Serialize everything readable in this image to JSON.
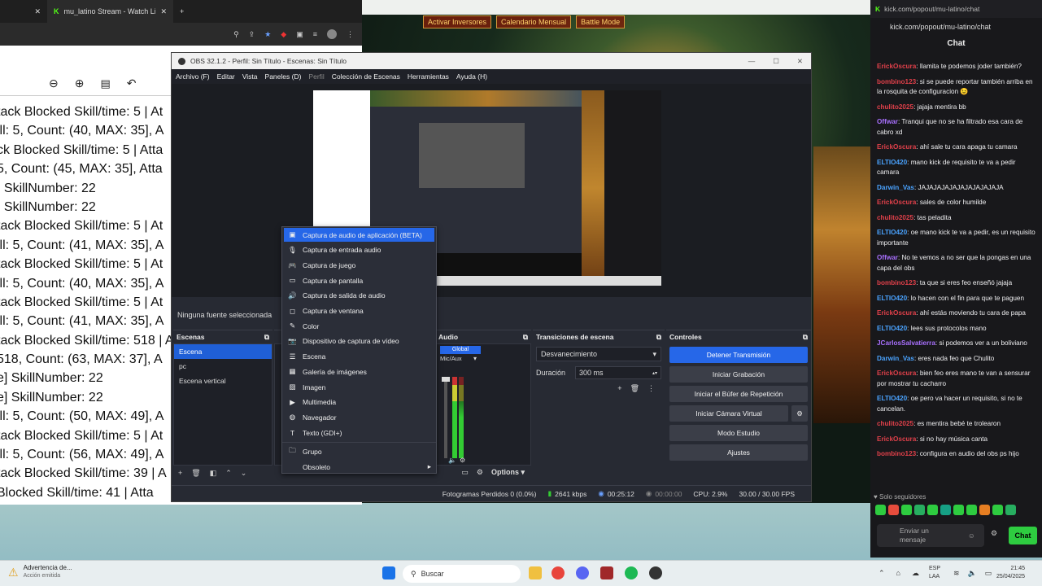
{
  "browser": {
    "tabs": [
      {
        "label": ""
      },
      {
        "label": "mu_latino Stream - Watch Live"
      }
    ],
    "log_lines": [
      "tack Blocked Skill/time: 5 | At",
      "ill: 5, Count: (40, MAX: 35], A",
      "ck Blocked Skill/time: 5 | Atta",
      "5, Count: (45, MAX: 35], Atta",
      "] SkillNumber: 22",
      "] SkillNumber: 22",
      "tack Blocked Skill/time: 5 | At",
      "ill: 5, Count: (41, MAX: 35], A",
      "tack Blocked Skill/time: 5 | At",
      "ill: 5, Count: (40, MAX: 35], A",
      "tack Blocked Skill/time: 5 | At",
      "ill: 5, Count: (41, MAX: 35], A",
      "tack Blocked Skill/time: 518 | A",
      " 518, Count: (63, MAX: 37], A",
      "e] SkillNumber: 22",
      "e] SkillNumber: 22",
      "ill: 5, Count: (50, MAX: 49], A",
      "tack Blocked Skill/time: 5 | At",
      "ill: 5, Count: (56, MAX: 49], A",
      "tack Blocked Skill/time: 39 | A",
      " Blocked Skill/time: 41 | Atta"
    ]
  },
  "game": {
    "hud": [
      "Activar Inversores",
      "Calendario Mensual",
      "Battle Mode"
    ]
  },
  "obs": {
    "title": "OBS 32.1.2 - Perfil: Sin Título - Escenas: Sin Título",
    "menu": [
      "Archivo (F)",
      "Editar",
      "Vista",
      "Paneles (D)",
      "Perfil",
      "Colección de Escenas",
      "Herramientas",
      "Ayuda (H)"
    ],
    "no_source": "Ninguna fuente seleccionada",
    "scenes": {
      "header": "Escenas",
      "items": [
        {
          "label": "Escena",
          "selected": true
        },
        {
          "label": "pc",
          "selected": false
        },
        {
          "label": "Escena vertical",
          "selected": false
        }
      ]
    },
    "audio": {
      "header": "Audio",
      "channel_label": "Global",
      "channel_name": "Mic/Aux"
    },
    "transitions": {
      "header": "Transiciones de escena",
      "selected": "Desvanecimiento",
      "duration_label": "Duración",
      "duration_value": "300 ms"
    },
    "controls": {
      "header": "Controles",
      "buttons": [
        "Detener Transmisión",
        "Iniciar Grabación",
        "Iniciar el Búfer de Repetición",
        "Iniciar Cámara Virtual",
        "Modo Estudio",
        "Ajustes"
      ]
    },
    "options_label": "Options",
    "status": {
      "dropped": "Fotogramas Perdidos 0 (0.0%)",
      "bitrate": "2641 kbps",
      "time": "00:25:12",
      "rec_time": "00:00:00",
      "cpu": "CPU: 2.9%",
      "fps": "30.00 / 30.00 FPS"
    },
    "context_menu": [
      {
        "label": "Captura de audio de aplicación (BETA)",
        "icon": "app-audio-icon",
        "highlighted": true
      },
      {
        "label": "Captura de entrada audio",
        "icon": "mic-icon"
      },
      {
        "label": "Captura de juego",
        "icon": "gamepad-icon"
      },
      {
        "label": "Captura de pantalla",
        "icon": "monitor-icon"
      },
      {
        "label": "Captura de salida de audio",
        "icon": "speaker-icon"
      },
      {
        "label": "Captura de ventana",
        "icon": "window-icon"
      },
      {
        "label": "Color",
        "icon": "brush-icon"
      },
      {
        "label": "Dispositivo de captura de vídeo",
        "icon": "camera-icon"
      },
      {
        "label": "Escena",
        "icon": "list-icon"
      },
      {
        "label": "Galería de imágenes",
        "icon": "gallery-icon"
      },
      {
        "label": "Imagen",
        "icon": "image-icon"
      },
      {
        "label": "Multimedia",
        "icon": "play-icon"
      },
      {
        "label": "Navegador",
        "icon": "globe-icon"
      },
      {
        "label": "Texto (GDI+)",
        "icon": "text-icon"
      },
      {
        "label": "Grupo",
        "icon": "folder-icon"
      },
      {
        "label": "Obsoleto",
        "icon": "chevron-right-icon"
      }
    ]
  },
  "chat": {
    "url": "kick.com/popout/mu-latino/chat",
    "title": "Chat",
    "messages": [
      {
        "user": "ErickOscura",
        "color": "#e0404a",
        "text": "llamita te podemos joder también?"
      },
      {
        "user": "bombino123",
        "color": "#e0404a",
        "text": "si se puede reportar también arriba en la rosquita de configuracion 😉"
      },
      {
        "user": "chulito2025",
        "color": "#e0404a",
        "text": "jajaja mentira bb"
      },
      {
        "user": "Offwar",
        "color": "#a970ff",
        "text": "Tranqui que no se ha filtrado esa cara de cabro xd"
      },
      {
        "user": "ErickOscura",
        "color": "#e0404a",
        "text": "ahí sale tu cara apaga tu camara"
      },
      {
        "user": "ELTIO420",
        "color": "#4aa3ff",
        "text": "mano kick de requisito te va a pedir camara"
      },
      {
        "user": "Darwin_Vas",
        "color": "#4aa3ff",
        "text": "JAJAJAJAJAJAJAJAJAJAJA"
      },
      {
        "user": "ErickOscura",
        "color": "#e0404a",
        "text": "sales de color humilde"
      },
      {
        "user": "chulito2025",
        "color": "#e0404a",
        "text": "tas peladita"
      },
      {
        "user": "ELTIO420",
        "color": "#4aa3ff",
        "text": "oe mano kick te va a pedir, es un requisito importante"
      },
      {
        "user": "Offwar",
        "color": "#a970ff",
        "text": "No te vemos a no ser que la pongas en una capa del obs"
      },
      {
        "user": "bombino123",
        "color": "#e0404a",
        "text": "ta que si eres feo enseñó jajaja"
      },
      {
        "user": "ELTIO420",
        "color": "#4aa3ff",
        "text": "lo hacen con el fin para que te paguen"
      },
      {
        "user": "ErickOscura",
        "color": "#e0404a",
        "text": "ahí estás moviendo tu cara de papa"
      },
      {
        "user": "ELTIO420",
        "color": "#4aa3ff",
        "text": "lees sus protocolos mano"
      },
      {
        "user": "JCarlosSalvatierra",
        "color": "#a970ff",
        "text": "si podemos ver a un boliviano"
      },
      {
        "user": "Darwin_Vas",
        "color": "#4aa3ff",
        "text": "eres nada feo que Chulito"
      },
      {
        "user": "ErickOscura",
        "color": "#e0404a",
        "text": "bien feo eres mano te van a sensurar por mostrar tu cacharro"
      },
      {
        "user": "ELTIO420",
        "color": "#4aa3ff",
        "text": "oe pero va hacer un requisito, si no te cancelan."
      },
      {
        "user": "chulito2025",
        "color": "#e0404a",
        "text": "es mentira bebé te trolearon"
      },
      {
        "user": "ErickOscura",
        "color": "#e0404a",
        "text": "si no hay música canta"
      },
      {
        "user": "bombino123",
        "color": "#e0404a",
        "text": "configura en audio del obs ps hijo"
      }
    ],
    "followers_only": "Solo seguidores",
    "input_placeholder": "Enviar un mensaje",
    "send_label": "Chat",
    "emote_colors": [
      "#2ecc40",
      "#e74c3c",
      "#2ecc40",
      "#27ae60",
      "#2ecc40",
      "#16a085",
      "#2ecc40",
      "#2ecc40",
      "#e67e22",
      "#2ecc40",
      "#27ae60"
    ]
  },
  "taskbar": {
    "notice_title": "Advertencia de...",
    "notice_sub": "Acción emitida",
    "search_label": "Buscar",
    "lang": "ESP",
    "lang2": "LAA",
    "time": "21:45",
    "date": "25/04/2025"
  }
}
